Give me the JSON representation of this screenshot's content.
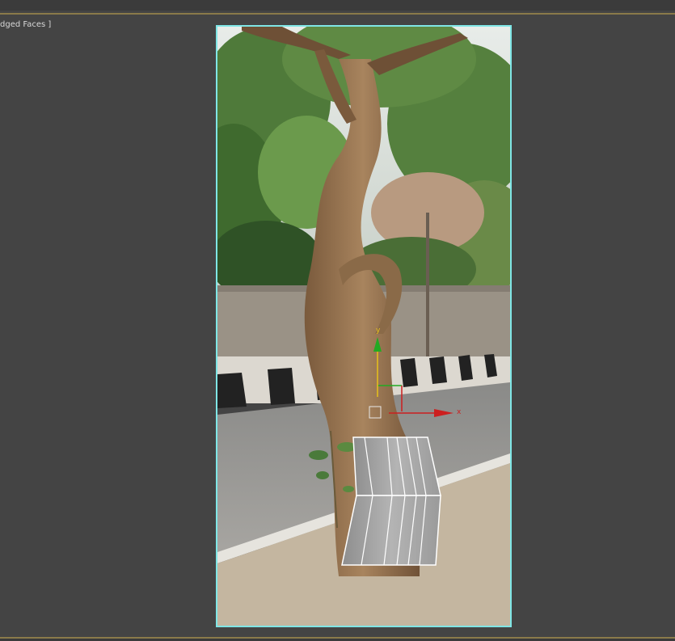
{
  "viewport": {
    "label": "dged Faces ]"
  },
  "gizmo": {
    "x_label": "x",
    "y_label": "y"
  },
  "colors": {
    "selection_outline": "#7fe6e6",
    "gizmo_x": "#cc1f1f",
    "gizmo_y": "#22aa22",
    "gizmo_center": "#e8c21a",
    "frame_accent": "#8a7a4a",
    "viewport_bg": "#444444"
  },
  "scene": {
    "object": "tree-photo-plane",
    "mesh": "bark-wrapped-trunk-mesh"
  }
}
